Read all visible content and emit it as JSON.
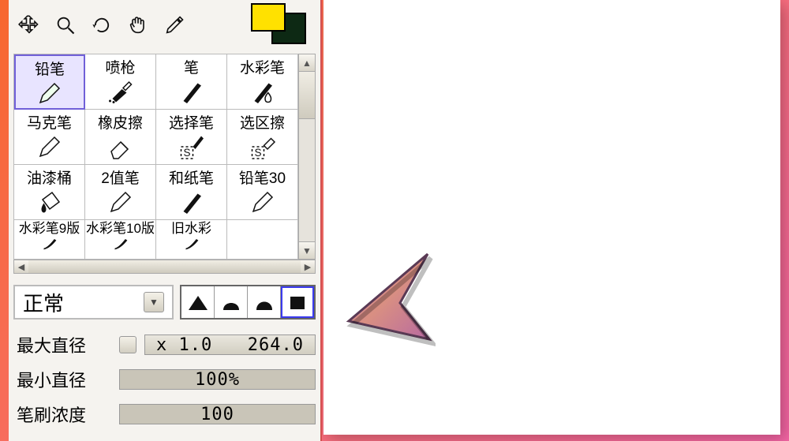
{
  "swatch": {
    "front": "#ffe100",
    "back": "#0d2914"
  },
  "toolbar": {
    "tools": [
      "move-tool",
      "zoom-tool",
      "rotate-tool",
      "hand-tool",
      "eyedropper-tool"
    ]
  },
  "brushes": {
    "rows": [
      [
        {
          "label": "铅笔",
          "icon": "pencil",
          "selected": true
        },
        {
          "label": "喷枪",
          "icon": "airbrush"
        },
        {
          "label": "笔",
          "icon": "brush"
        },
        {
          "label": "水彩笔",
          "icon": "watercolor"
        }
      ],
      [
        {
          "label": "马克笔",
          "icon": "pencil2"
        },
        {
          "label": "橡皮擦",
          "icon": "eraser"
        },
        {
          "label": "选择笔",
          "icon": "selectpen"
        },
        {
          "label": "选区擦",
          "icon": "selerase"
        }
      ],
      [
        {
          "label": "油漆桶",
          "icon": "bucket"
        },
        {
          "label": "2值笔",
          "icon": "pencil2"
        },
        {
          "label": "和纸笔",
          "icon": "brush"
        },
        {
          "label": "铅笔30",
          "icon": "pencil"
        }
      ],
      [
        {
          "label": "水彩笔9版",
          "icon": "water2"
        },
        {
          "label": "水彩笔10版",
          "icon": "water2"
        },
        {
          "label": "旧水彩",
          "icon": "water2"
        },
        {
          "label": "",
          "icon": ""
        }
      ]
    ]
  },
  "blend_mode": {
    "label": "正常"
  },
  "brush_shapes": [
    "triangle",
    "round",
    "round2",
    "square"
  ],
  "brush_shape_selected": 3,
  "sliders": {
    "max_diameter_label": "最大直径",
    "max_multiplier": "x 1.0",
    "max_value": "264.0",
    "min_diameter_label": "最小直径",
    "min_value": "100%",
    "density_label": "笔刷浓度",
    "density_value": "100"
  }
}
